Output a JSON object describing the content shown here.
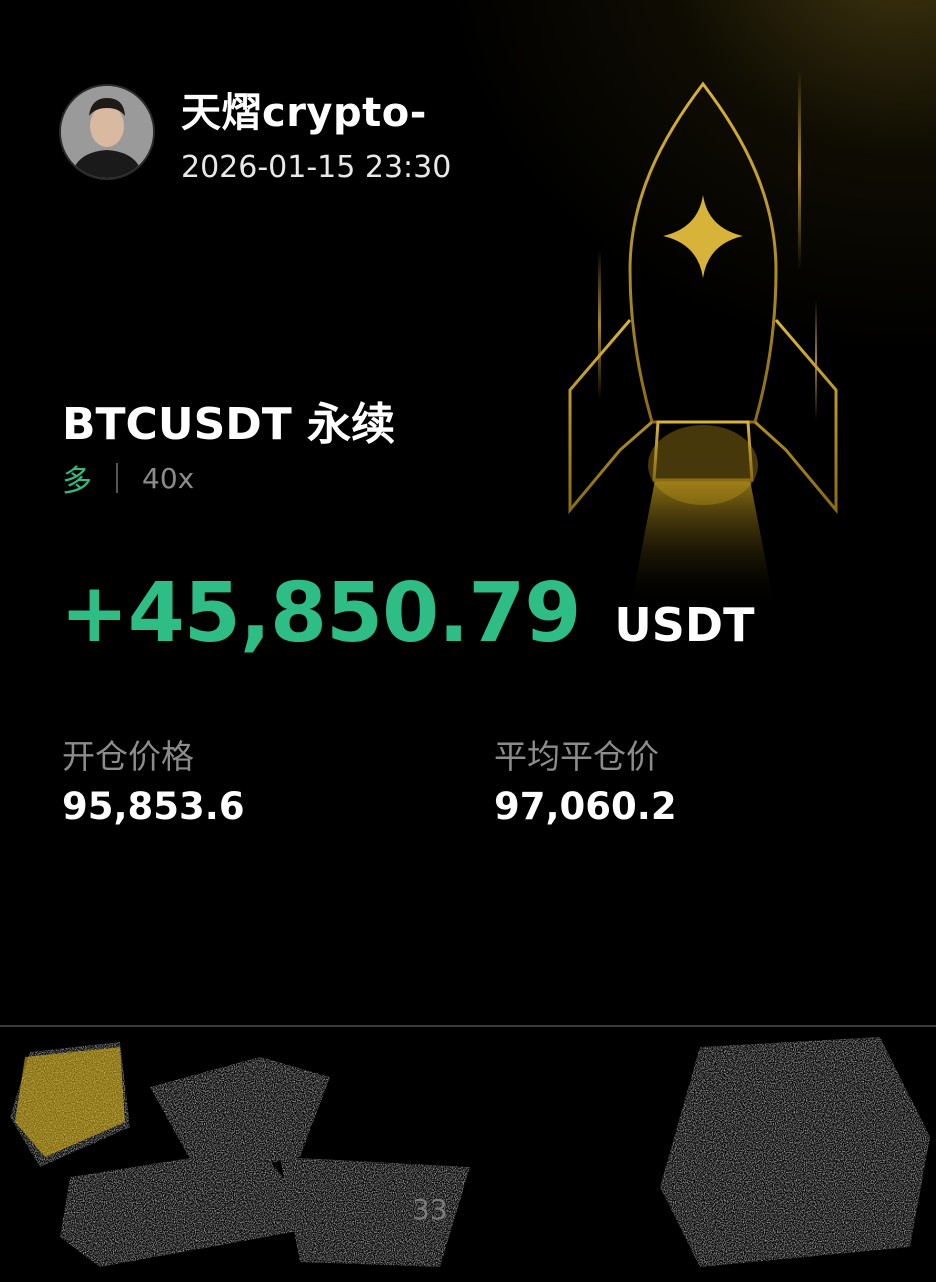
{
  "user": {
    "name": "天熠crypto-",
    "timestamp": "2026-01-15 23:30",
    "avatar_icon": "user-portrait"
  },
  "position": {
    "symbol": "BTCUSDT 永续",
    "side": "多",
    "leverage": "40x",
    "pnl": "+45,850.79",
    "currency": "USDT"
  },
  "stats": {
    "open_price_label": "开仓价格",
    "open_price_value": "95,853.6",
    "close_price_label": "平均平仓价",
    "close_price_value": "97,060.2"
  },
  "footer": {
    "partial_text": "33"
  },
  "colors": {
    "profit_green": "#2ebd85",
    "rocket_gold": "#c9a227",
    "background": "#000000"
  }
}
